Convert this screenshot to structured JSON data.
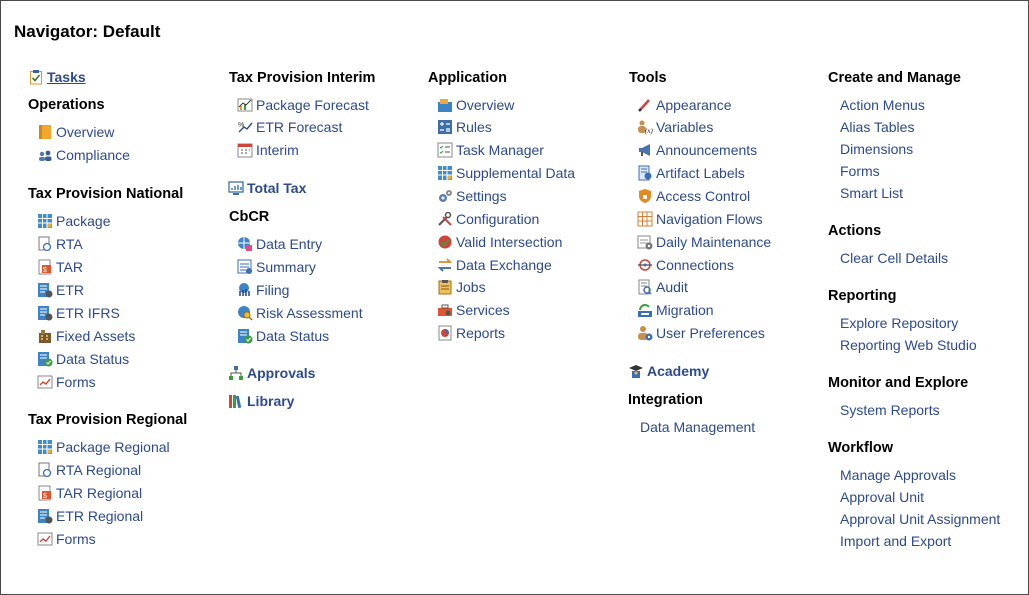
{
  "title": "Navigator: Default",
  "col1": {
    "tasks": "Tasks",
    "operations": {
      "heading": "Operations",
      "items": [
        "Overview",
        "Compliance"
      ]
    },
    "national": {
      "heading": "Tax Provision National",
      "items": [
        "Package",
        "RTA",
        "TAR",
        "ETR",
        "ETR IFRS",
        "Fixed Assets",
        "Data Status",
        "Forms"
      ]
    },
    "regional": {
      "heading": "Tax Provision Regional",
      "items": [
        "Package Regional",
        "RTA Regional",
        "TAR Regional",
        "ETR Regional",
        "Forms"
      ]
    }
  },
  "col2": {
    "interim": {
      "heading": "Tax Provision Interim",
      "items": [
        "Package Forecast",
        "ETR Forecast",
        "Interim"
      ]
    },
    "total_tax": "Total Tax",
    "cbcr": {
      "heading": "CbCR",
      "items": [
        "Data Entry",
        "Summary",
        "Filing",
        "Risk Assessment",
        "Data Status"
      ]
    },
    "approvals": "Approvals",
    "library": "Library"
  },
  "col3": {
    "application": {
      "heading": "Application",
      "items": [
        "Overview",
        "Rules",
        "Task Manager",
        "Supplemental Data",
        "Settings",
        "Configuration",
        "Valid Intersection",
        "Data Exchange",
        "Jobs",
        "Services",
        "Reports"
      ]
    }
  },
  "col4": {
    "tools": {
      "heading": "Tools",
      "items": [
        "Appearance",
        "Variables",
        "Announcements",
        "Artifact Labels",
        "Access Control",
        "Navigation Flows",
        "Daily Maintenance",
        "Connections",
        "Audit",
        "Migration",
        "User Preferences"
      ]
    },
    "academy": "Academy",
    "integration": {
      "heading": "Integration",
      "items": [
        "Data Management"
      ]
    }
  },
  "col5": {
    "create": {
      "heading": "Create and Manage",
      "items": [
        "Action Menus",
        "Alias Tables",
        "Dimensions",
        "Forms",
        "Smart List"
      ]
    },
    "actions": {
      "heading": "Actions",
      "items": [
        "Clear Cell Details"
      ]
    },
    "reporting": {
      "heading": "Reporting",
      "items": [
        "Explore Repository",
        "Reporting Web Studio"
      ]
    },
    "monitor": {
      "heading": "Monitor and Explore",
      "items": [
        "System Reports"
      ]
    },
    "workflow": {
      "heading": "Workflow",
      "items": [
        "Manage Approvals",
        "Approval Unit",
        "Approval Unit Assignment",
        "Import and Export"
      ]
    }
  }
}
